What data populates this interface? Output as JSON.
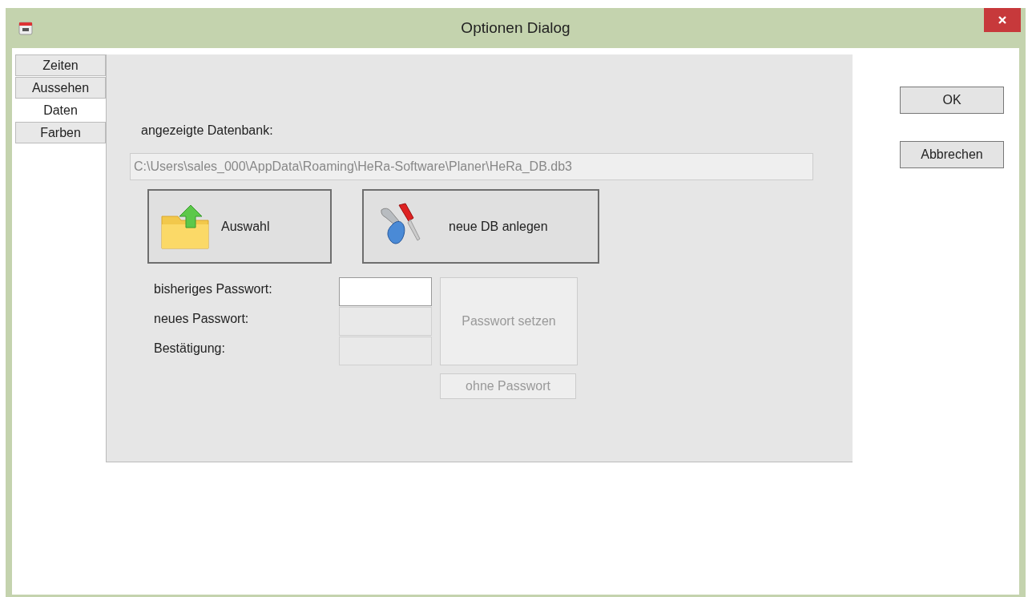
{
  "window": {
    "title": "Optionen Dialog"
  },
  "tabs": [
    {
      "label": "Zeiten",
      "selected": false
    },
    {
      "label": "Aussehen",
      "selected": false
    },
    {
      "label": "Daten",
      "selected": true
    },
    {
      "label": "Farben",
      "selected": false
    }
  ],
  "database": {
    "label": "angezeigte Datenbank:",
    "path": "C:\\Users\\sales_000\\AppData\\Roaming\\HeRa-Software\\Planer\\HeRa_DB.db3",
    "disabled": true
  },
  "actions": [
    {
      "label": "Auswahl",
      "kind": "folder"
    },
    {
      "label": "neue DB anlegen",
      "kind": "tools"
    }
  ],
  "password_fields": [
    {
      "label": "bisheriges Passwort:",
      "disabled": false
    },
    {
      "label": "neues Passwort:",
      "disabled": true
    },
    {
      "label": "Bestätigung:",
      "disabled": true
    }
  ],
  "set_password_button": {
    "label": "Passwort setzen",
    "disabled": true
  },
  "no_password_button": {
    "label": "ohne Passwort",
    "disabled": true
  },
  "dialog_buttons": [
    "OK",
    "Abbrechen"
  ]
}
